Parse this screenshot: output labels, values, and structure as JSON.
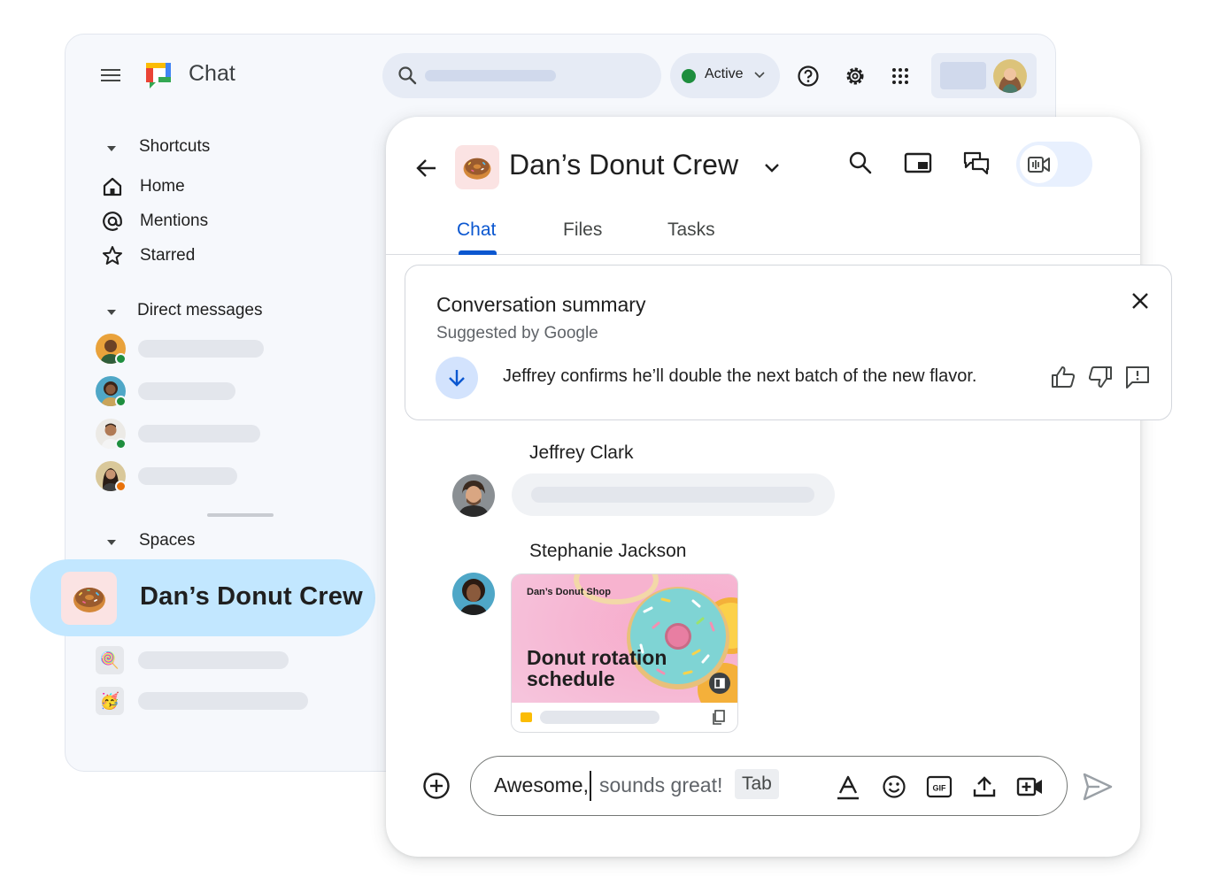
{
  "app": {
    "title": "Chat"
  },
  "topbar": {
    "status_label": "Active"
  },
  "sidebar": {
    "shortcuts_header": "Shortcuts",
    "shortcuts": [
      {
        "label": "Home",
        "icon": "home-icon"
      },
      {
        "label": "Mentions",
        "icon": "at-icon"
      },
      {
        "label": "Starred",
        "icon": "star-icon"
      }
    ],
    "dm_header": "Direct messages",
    "spaces_header": "Spaces",
    "selected_space": "Dan’s Donut Crew"
  },
  "conversation": {
    "title": "Dan’s Donut Crew",
    "tabs": [
      {
        "label": "Chat",
        "active": true
      },
      {
        "label": "Files",
        "active": false
      },
      {
        "label": "Tasks",
        "active": false
      }
    ]
  },
  "summary": {
    "title": "Conversation summary",
    "subtitle": "Suggested by Google",
    "text": "Jeffrey confirms he’ll double the next batch of the new flavor."
  },
  "messages": [
    {
      "sender": "Jeffrey Clark"
    },
    {
      "sender": "Stephanie Jackson",
      "attachment": {
        "brand": "Dan’s Donut Shop",
        "title": "Donut rotation schedule"
      }
    }
  ],
  "composer": {
    "typed": "Awesome,",
    "suggestion": "sounds great!",
    "accept_hint": "Tab"
  },
  "colors": {
    "accent": "#0b57d0",
    "active_status": "#1e8e3e",
    "selected_space_bg": "#c2e7ff",
    "window_bg": "#f6f8fc"
  }
}
